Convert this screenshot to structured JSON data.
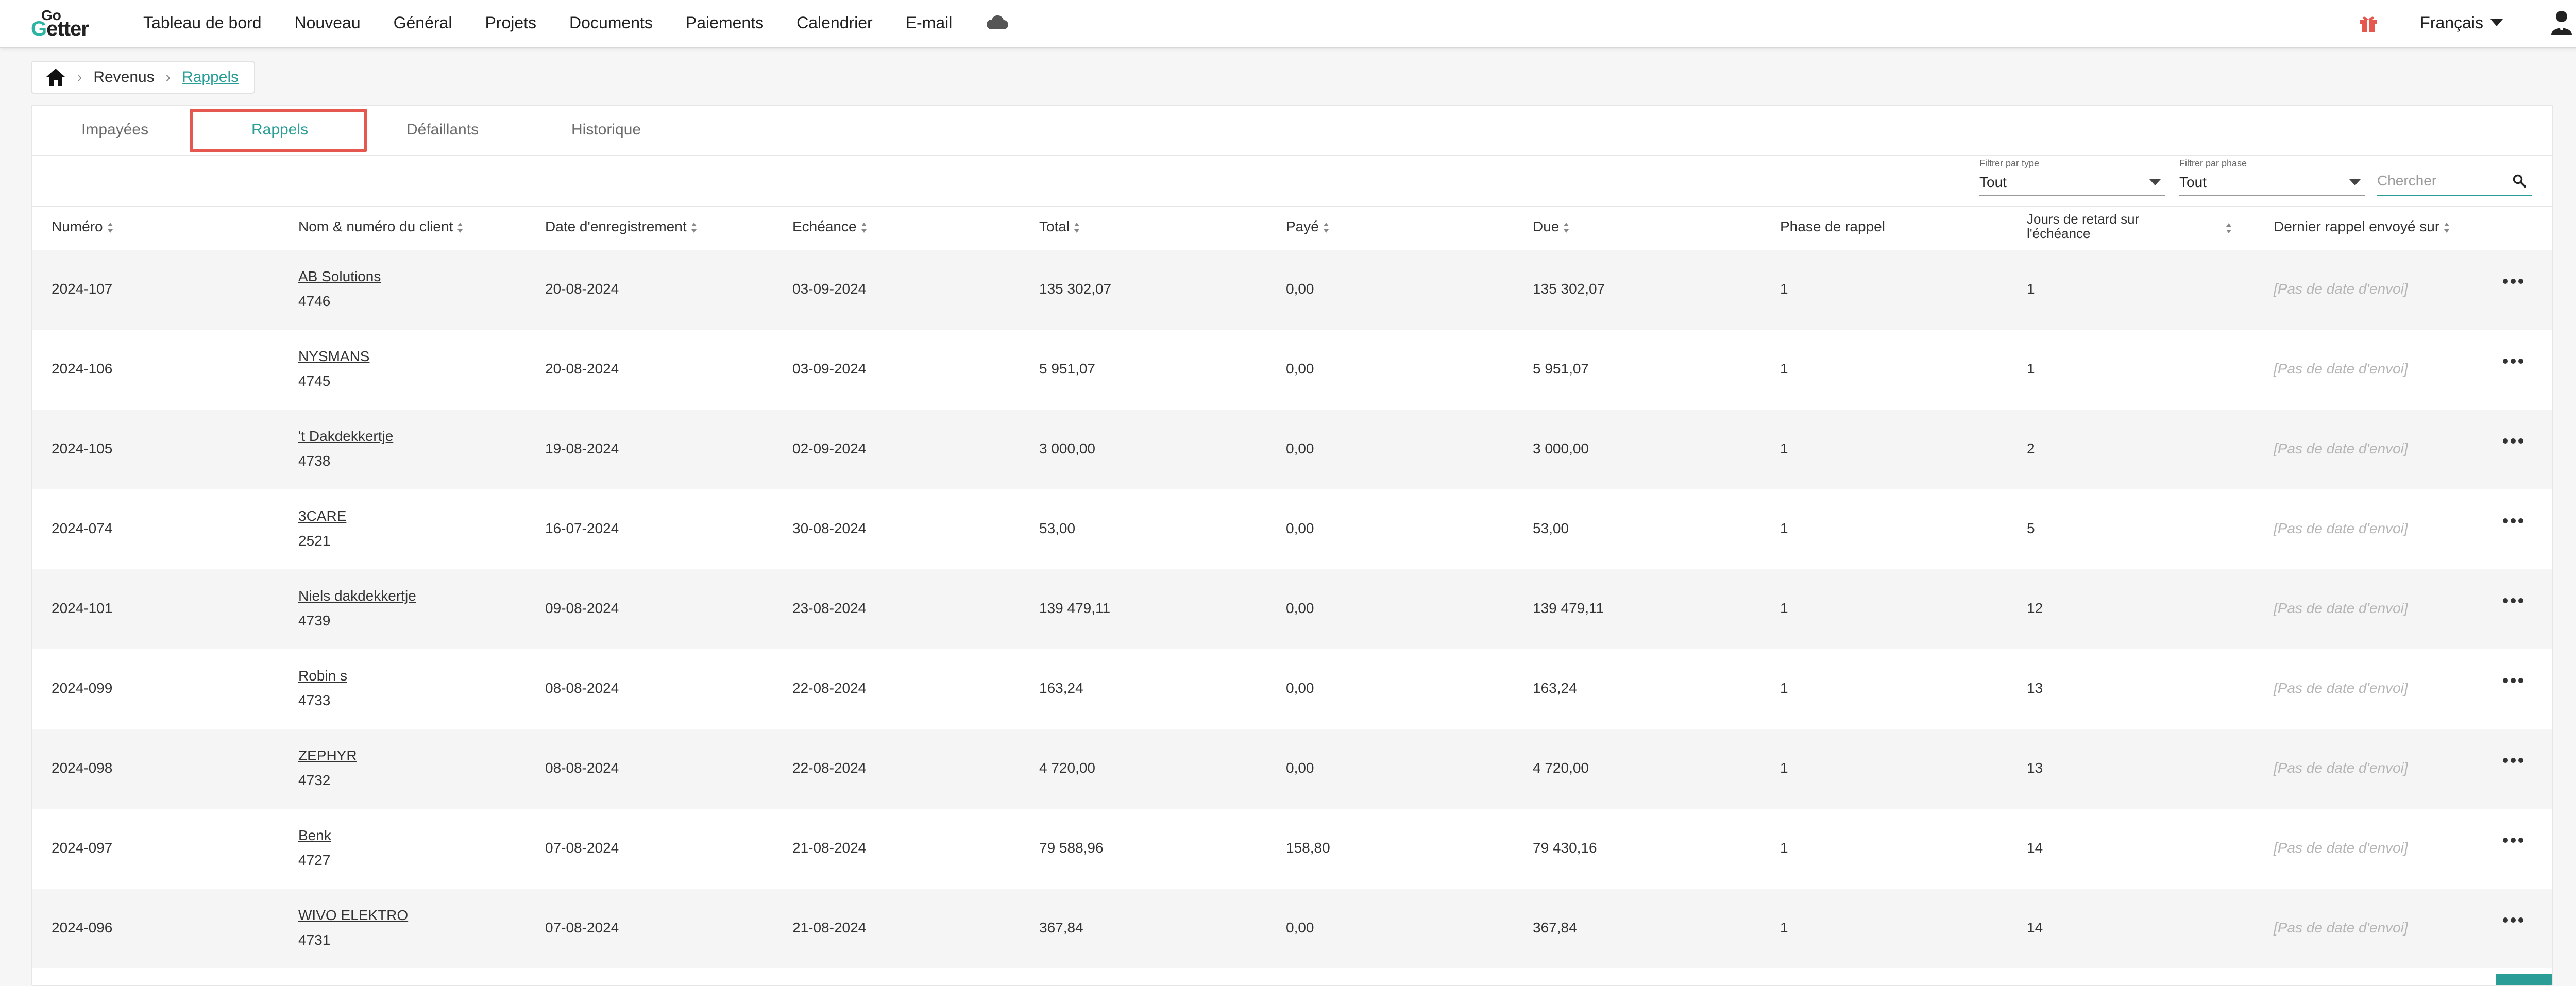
{
  "header": {
    "nav": [
      "Tableau de bord",
      "Nouveau",
      "Général",
      "Projets",
      "Documents",
      "Paiements",
      "Calendrier",
      "E-mail"
    ],
    "language": "Français",
    "icons": {
      "cloud": "cloud-icon",
      "gift": "gift-icon",
      "user": "user-icon"
    }
  },
  "breadcrumb": {
    "items": [
      "Revenus",
      "Rappels"
    ]
  },
  "tabs": [
    "Impayées",
    "Rappels",
    "Défaillants",
    "Historique"
  ],
  "active_tab": "Rappels",
  "filters": {
    "type_label": "Filtrer par type",
    "type_value": "Tout",
    "phase_label": "Filtrer par phase",
    "phase_value": "Tout",
    "search_placeholder": "Chercher"
  },
  "table": {
    "columns": [
      "Numéro",
      "Nom & numéro du client",
      "Date d'enregistrement",
      "Echéance",
      "Total",
      "Payé",
      "Due",
      "Phase de rappel",
      "Jours de retard sur l'échéance",
      "Dernier rappel envoyé sur"
    ],
    "rows": [
      {
        "numero": "2024-107",
        "client": "AB Solutions",
        "client_no": "4746",
        "date": "20-08-2024",
        "echeance": "03-09-2024",
        "total": "135 302,07",
        "paye": "0,00",
        "due": "135 302,07",
        "phase": "1",
        "jours": "1",
        "dernier": "[Pas de date d'envoi]"
      },
      {
        "numero": "2024-106",
        "client": "NYSMANS",
        "client_no": "4745",
        "date": "20-08-2024",
        "echeance": "03-09-2024",
        "total": "5 951,07",
        "paye": "0,00",
        "due": "5 951,07",
        "phase": "1",
        "jours": "1",
        "dernier": "[Pas de date d'envoi]"
      },
      {
        "numero": "2024-105",
        "client": "'t Dakdekkertje",
        "client_no": "4738",
        "date": "19-08-2024",
        "echeance": "02-09-2024",
        "total": "3 000,00",
        "paye": "0,00",
        "due": "3 000,00",
        "phase": "1",
        "jours": "2",
        "dernier": "[Pas de date d'envoi]"
      },
      {
        "numero": "2024-074",
        "client": "3CARE",
        "client_no": "2521",
        "date": "16-07-2024",
        "echeance": "30-08-2024",
        "total": "53,00",
        "paye": "0,00",
        "due": "53,00",
        "phase": "1",
        "jours": "5",
        "dernier": "[Pas de date d'envoi]"
      },
      {
        "numero": "2024-101",
        "client": "Niels dakdekkertje",
        "client_no": "4739",
        "date": "09-08-2024",
        "echeance": "23-08-2024",
        "total": "139 479,11",
        "paye": "0,00",
        "due": "139 479,11",
        "phase": "1",
        "jours": "12",
        "dernier": "[Pas de date d'envoi]"
      },
      {
        "numero": "2024-099",
        "client": "Robin s",
        "client_no": "4733",
        "date": "08-08-2024",
        "echeance": "22-08-2024",
        "total": "163,24",
        "paye": "0,00",
        "due": "163,24",
        "phase": "1",
        "jours": "13",
        "dernier": "[Pas de date d'envoi]"
      },
      {
        "numero": "2024-098",
        "client": "ZEPHYR",
        "client_no": "4732",
        "date": "08-08-2024",
        "echeance": "22-08-2024",
        "total": "4 720,00",
        "paye": "0,00",
        "due": "4 720,00",
        "phase": "1",
        "jours": "13",
        "dernier": "[Pas de date d'envoi]"
      },
      {
        "numero": "2024-097",
        "client": "Benk",
        "client_no": "4727",
        "date": "07-08-2024",
        "echeance": "21-08-2024",
        "total": "79 588,96",
        "paye": "158,80",
        "due": "79 430,16",
        "phase": "1",
        "jours": "14",
        "dernier": "[Pas de date d'envoi]"
      },
      {
        "numero": "2024-096",
        "client": "WIVO ELEKTRO",
        "client_no": "4731",
        "date": "07-08-2024",
        "echeance": "21-08-2024",
        "total": "367,84",
        "paye": "0,00",
        "due": "367,84",
        "phase": "1",
        "jours": "14",
        "dernier": "[Pas de date d'envoi]"
      }
    ]
  },
  "colors": {
    "accent": "#2a9d96",
    "highlight": "#e5584f"
  }
}
